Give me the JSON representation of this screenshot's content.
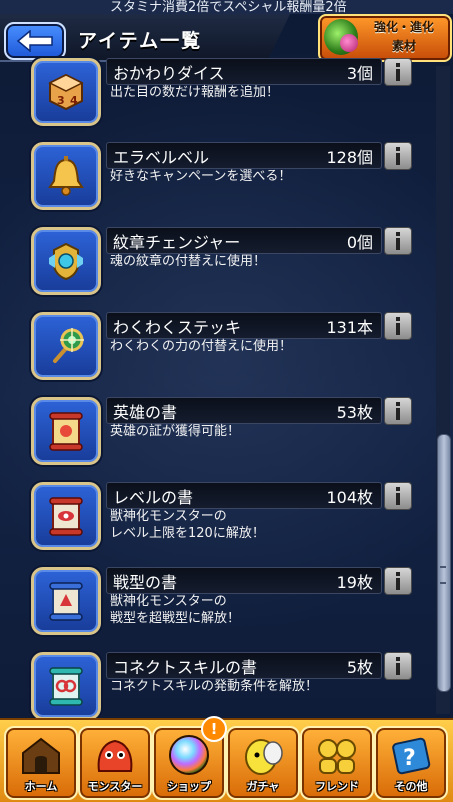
{
  "header": {
    "top_note": "スタミナ消費2倍でスペシャル報酬量2倍",
    "title": "アイテム一覧",
    "evo_label_line1": "強化・進化",
    "evo_label_line2": "素材"
  },
  "items": [
    {
      "name": "おかわりダイス",
      "count": "3個",
      "desc1": "出た目の数だけ報酬を追加！",
      "desc2": "",
      "icon": "dice-icon"
    },
    {
      "name": "エラベルベル",
      "count": "128個",
      "desc1": "好きなキャンペーンを選べる！",
      "desc2": "",
      "icon": "bell-icon"
    },
    {
      "name": "紋章チェンジャー",
      "count": "0個",
      "desc1": "魂の紋章の付替えに使用！",
      "desc2": "",
      "icon": "emblem-changer-icon"
    },
    {
      "name": "わくわくステッキ",
      "count": "131本",
      "desc1": "わくわくの力の付替えに使用！",
      "desc2": "",
      "icon": "wand-icon"
    },
    {
      "name": "英雄の書",
      "count": "53枚",
      "desc1": "英雄の証が獲得可能！",
      "desc2": "",
      "icon": "scroll-icon"
    },
    {
      "name": "レベルの書",
      "count": "104枚",
      "desc1": "獣神化モンスターの",
      "desc2": "レベル上限を120に解放！",
      "icon": "scroll-icon"
    },
    {
      "name": "戦型の書",
      "count": "19枚",
      "desc1": "獣神化モンスターの",
      "desc2": "戦型を超戦型に解放！",
      "icon": "scroll-icon"
    },
    {
      "name": "コネクトスキルの書",
      "count": "5枚",
      "desc1": "コネクトスキルの発動条件を解放！",
      "desc2": "",
      "icon": "scroll-icon"
    }
  ],
  "nav": {
    "home": "ホーム",
    "monster": "モンスター",
    "shop": "ショップ",
    "gacha": "ガチャ",
    "friend": "フレンド",
    "other": "その他",
    "shop_badge": "!"
  },
  "colors": {
    "accent_blue": "#2d63d8",
    "nav_orange": "#e08a12",
    "panel_dark": "#0e1a33"
  }
}
